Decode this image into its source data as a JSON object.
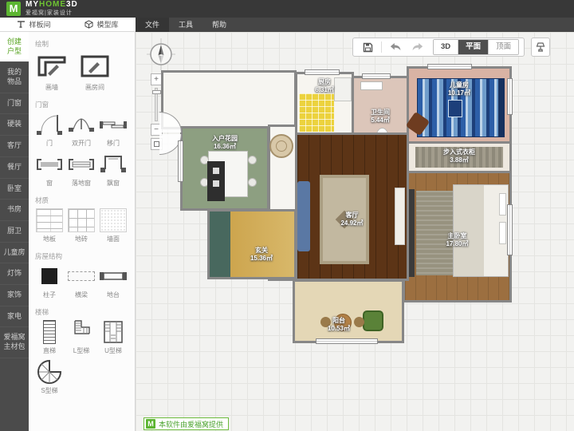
{
  "brand": {
    "logo_letter": "M",
    "name_my": "MY",
    "name_home": "HOME",
    "name_3d": "3D",
    "subtitle": "爱福窝|家装设计"
  },
  "tabs": {
    "sample": "样板间",
    "models": "模型库"
  },
  "menus": {
    "file": "文件",
    "tools": "工具",
    "help": "帮助"
  },
  "sidebar": {
    "items": [
      {
        "label": "创建\n户型",
        "active": true
      },
      {
        "label": "我的\n物品"
      },
      {
        "label": "门窗"
      },
      {
        "label": "硬装"
      },
      {
        "label": "客厅"
      },
      {
        "label": "餐厅"
      },
      {
        "label": "卧室"
      },
      {
        "label": "书房"
      },
      {
        "label": "厨卫"
      },
      {
        "label": "儿童房"
      },
      {
        "label": "灯饰"
      },
      {
        "label": "家饰"
      },
      {
        "label": "家电"
      },
      {
        "label": "爱福窝\n主材包"
      }
    ]
  },
  "tools": {
    "sections": [
      {
        "title": "绘制",
        "items": [
          "画墙",
          "画房间"
        ]
      },
      {
        "title": "门窗",
        "items": [
          "门",
          "双开门",
          "移门",
          "窗",
          "落地窗",
          "飘窗"
        ]
      },
      {
        "title": "材质",
        "items": [
          "地板",
          "地砖",
          "墙面"
        ]
      },
      {
        "title": "房屋结构",
        "items": [
          "柱子",
          "横梁",
          "地台"
        ]
      },
      {
        "title": "楼梯",
        "items": [
          "直梯",
          "L型梯",
          "U型梯",
          "S型梯"
        ]
      }
    ]
  },
  "toolbar": {
    "view_3d": "3D",
    "view_plan": "平面",
    "view_ceiling": "顶面"
  },
  "zoom": {
    "in": "+",
    "out": "−"
  },
  "rooms": [
    {
      "name": "厨房",
      "area": "6.31㎡"
    },
    {
      "name": "卫生间",
      "area": "5.44㎡"
    },
    {
      "name": "儿童房",
      "area": "10.17㎡"
    },
    {
      "name": "步入式衣柜",
      "area": "3.88㎡"
    },
    {
      "name": "主卧室",
      "area": "17.80㎡"
    },
    {
      "name": "入户花园",
      "area": "16.36㎡"
    },
    {
      "name": "客厅",
      "area": "24.92㎡"
    },
    {
      "name": "玄关",
      "area": "15.36㎡"
    },
    {
      "name": "阳台",
      "area": "10.53㎡"
    }
  ],
  "footer": {
    "logo_letter": "M",
    "provider": "本软件由爱福窝提供"
  },
  "colors": {
    "brand_green": "#5cb531",
    "topbar": "#383838",
    "sidebar": "#4b4b4b",
    "active_view_bg": "#4f4f4f",
    "wall": "#878787",
    "canvas": "#f2f2f0"
  }
}
